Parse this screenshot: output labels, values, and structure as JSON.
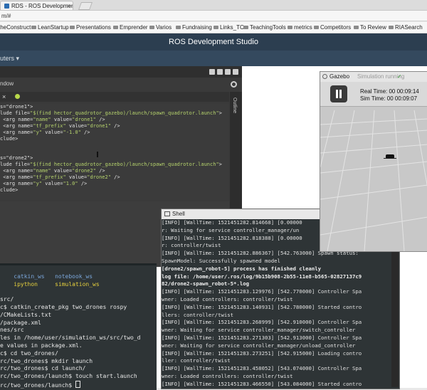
{
  "browser": {
    "tab_title": "RDS - ROS Development",
    "url": "m/#",
    "bookmarks": [
      "theConstruct",
      "LeanStartup",
      "Presentations",
      "Emprender",
      "Varios",
      "Fundraising",
      "Links_TC",
      "TeachingTools",
      "metrics",
      "Competitors",
      "To Review",
      "RIASearch"
    ]
  },
  "app": {
    "title": "ROS Development Studio",
    "nav_menu": "uters ▾"
  },
  "ide": {
    "window_label": "ndow",
    "outline_label": "Outline",
    "code_lines": [
      {
        "pre": "s=\"drone1\">",
        "str": ""
      },
      {
        "pre": "lude file=",
        "str": "\"$(find hector_quadrotor_gazebo)/launch/spawn_quadrotor.launch\"",
        "post": ">"
      },
      {
        "pre": " <arg name=",
        "str": "\"name\"",
        "mid": " value=",
        "str2": "\"drone1\"",
        "post": " />"
      },
      {
        "pre": " <arg name=",
        "str": "\"tf_prefix\"",
        "mid": " value=",
        "str2": "\"drone1\"",
        "post": " />"
      },
      {
        "pre": " <arg name=",
        "str": "\"y\"",
        "mid": " value=",
        "str2": "\"-1.0\"",
        "post": " />"
      },
      {
        "pre": "clude>",
        "str": ""
      },
      {
        "pre": "",
        "str": ""
      },
      {
        "pre": "",
        "str": ""
      },
      {
        "pre": "s=\"drone2\">",
        "str": ""
      },
      {
        "pre": "lude file=",
        "str": "\"$(find hector_quadrotor_gazebo)/launch/spawn_quadrotor.launch\"",
        "post": ">"
      },
      {
        "pre": " <arg name=",
        "str": "\"name\"",
        "mid": " value=",
        "str2": "\"drone2\"",
        "post": " />"
      },
      {
        "pre": " <arg name=",
        "str": "\"tf_prefix\"",
        "mid": " value=",
        "str2": "\"drone2\"",
        "post": " />"
      },
      {
        "pre": " <arg name=",
        "str": "\"y\"",
        "mid": " value=",
        "str2": "\"1.0\"",
        "post": " />"
      },
      {
        "pre": "clude>",
        "str": ""
      }
    ]
  },
  "terminal": {
    "lines": [
      {
        "text": "",
        "cls": ""
      },
      {
        "text": "    catkin_ws   notebook_ws",
        "cls": "blue"
      },
      {
        "text": "    ipython     simulation_ws",
        "cls": "yel"
      },
      {
        "text": "",
        "cls": ""
      },
      {
        "text": "src/",
        "cls": ""
      },
      {
        "text": "c$ catkin_create_pkg two_drones rospy",
        "cls": ""
      },
      {
        "text": "/CMakeLists.txt",
        "cls": ""
      },
      {
        "text": "/package.xml",
        "cls": ""
      },
      {
        "text": "nes/src",
        "cls": ""
      },
      {
        "text": "les in /home/user/simulation_ws/src/two_d",
        "cls": ""
      },
      {
        "text": "e values in package.xml.",
        "cls": ""
      },
      {
        "text": "c$ cd two_drones/",
        "cls": ""
      },
      {
        "text": "rc/two_drones$ mkdir launch",
        "cls": ""
      },
      {
        "text": "rc/two_drones$ cd launch/",
        "cls": ""
      },
      {
        "text": "rc/two_drones/launch$ touch start.launch",
        "cls": ""
      },
      {
        "text": "rc/two_drones/launch$ ",
        "cls": "",
        "cursor": true
      }
    ]
  },
  "shell": {
    "title": "Shell",
    "lines": [
      {
        "text": "[INFO] [WallTime: 1521451282.814668] [0.00000",
        "bold": false
      },
      {
        "text": "r: Waiting for service controller_manager/un",
        "bold": false
      },
      {
        "text": "[INFO] [WallTime: 1521451282.818388] [0.00000",
        "bold": false
      },
      {
        "text": "r: controller/twist",
        "bold": false
      },
      {
        "text": "[INFO] [WallTime: 1521451282.886367] [542.763000] Spawn status:",
        "bold": false
      },
      {
        "text": "SpawnModel: Successfully spawned model",
        "bold": false
      },
      {
        "text": "[drone2/spawn_robot-5] process has finished cleanly",
        "bold": true
      },
      {
        "text": "log file: /home/user/.ros/log/9b15b908-2b55-11e8-b565-02827137c9",
        "bold": true
      },
      {
        "text": "82/drone2-spawn_robot-5*.log",
        "bold": true
      },
      {
        "text": "[INFO] [WallTime: 1521451283.129976] [542.770000] Controller Spa",
        "bold": false
      },
      {
        "text": "wner: Loaded controllers: controller/twist",
        "bold": false
      },
      {
        "text": "[INFO] [WallTime: 1521451283.140931] [542.780000] Started contro",
        "bold": false
      },
      {
        "text": "llers: controller/twist",
        "bold": false
      },
      {
        "text": "[INFO] [WallTime: 1521451283.268999] [542.910000] Controller Spa",
        "bold": false
      },
      {
        "text": "wner: Waiting for service controller_manager/switch_controller",
        "bold": false
      },
      {
        "text": "[INFO] [WallTime: 1521451283.271303] [542.913000] Controller Spa",
        "bold": false
      },
      {
        "text": "wner: Waiting for service controller_manager/unload_controller",
        "bold": false
      },
      {
        "text": "[INFO] [WallTime: 1521451283.273251] [542.915000] Loading contro",
        "bold": false
      },
      {
        "text": "ller: controller/twist",
        "bold": false
      },
      {
        "text": "[INFO] [WallTime: 1521451283.458052] [543.074000] Controller Spa",
        "bold": false
      },
      {
        "text": "wner: Loaded controllers: controller/twist",
        "bold": false
      },
      {
        "text": "[INFO] [WallTime: 1521451283.466550] [543.084000] Started contro",
        "bold": false
      },
      {
        "text": "llers: controller/twist",
        "bold": false
      }
    ]
  },
  "gazebo": {
    "title": "Gazebo",
    "status": "Simulation running",
    "check": "✓",
    "real_time": "Real Time: 00 00:09:14",
    "sim_time": "Sim Time: 00 00:09:07"
  }
}
